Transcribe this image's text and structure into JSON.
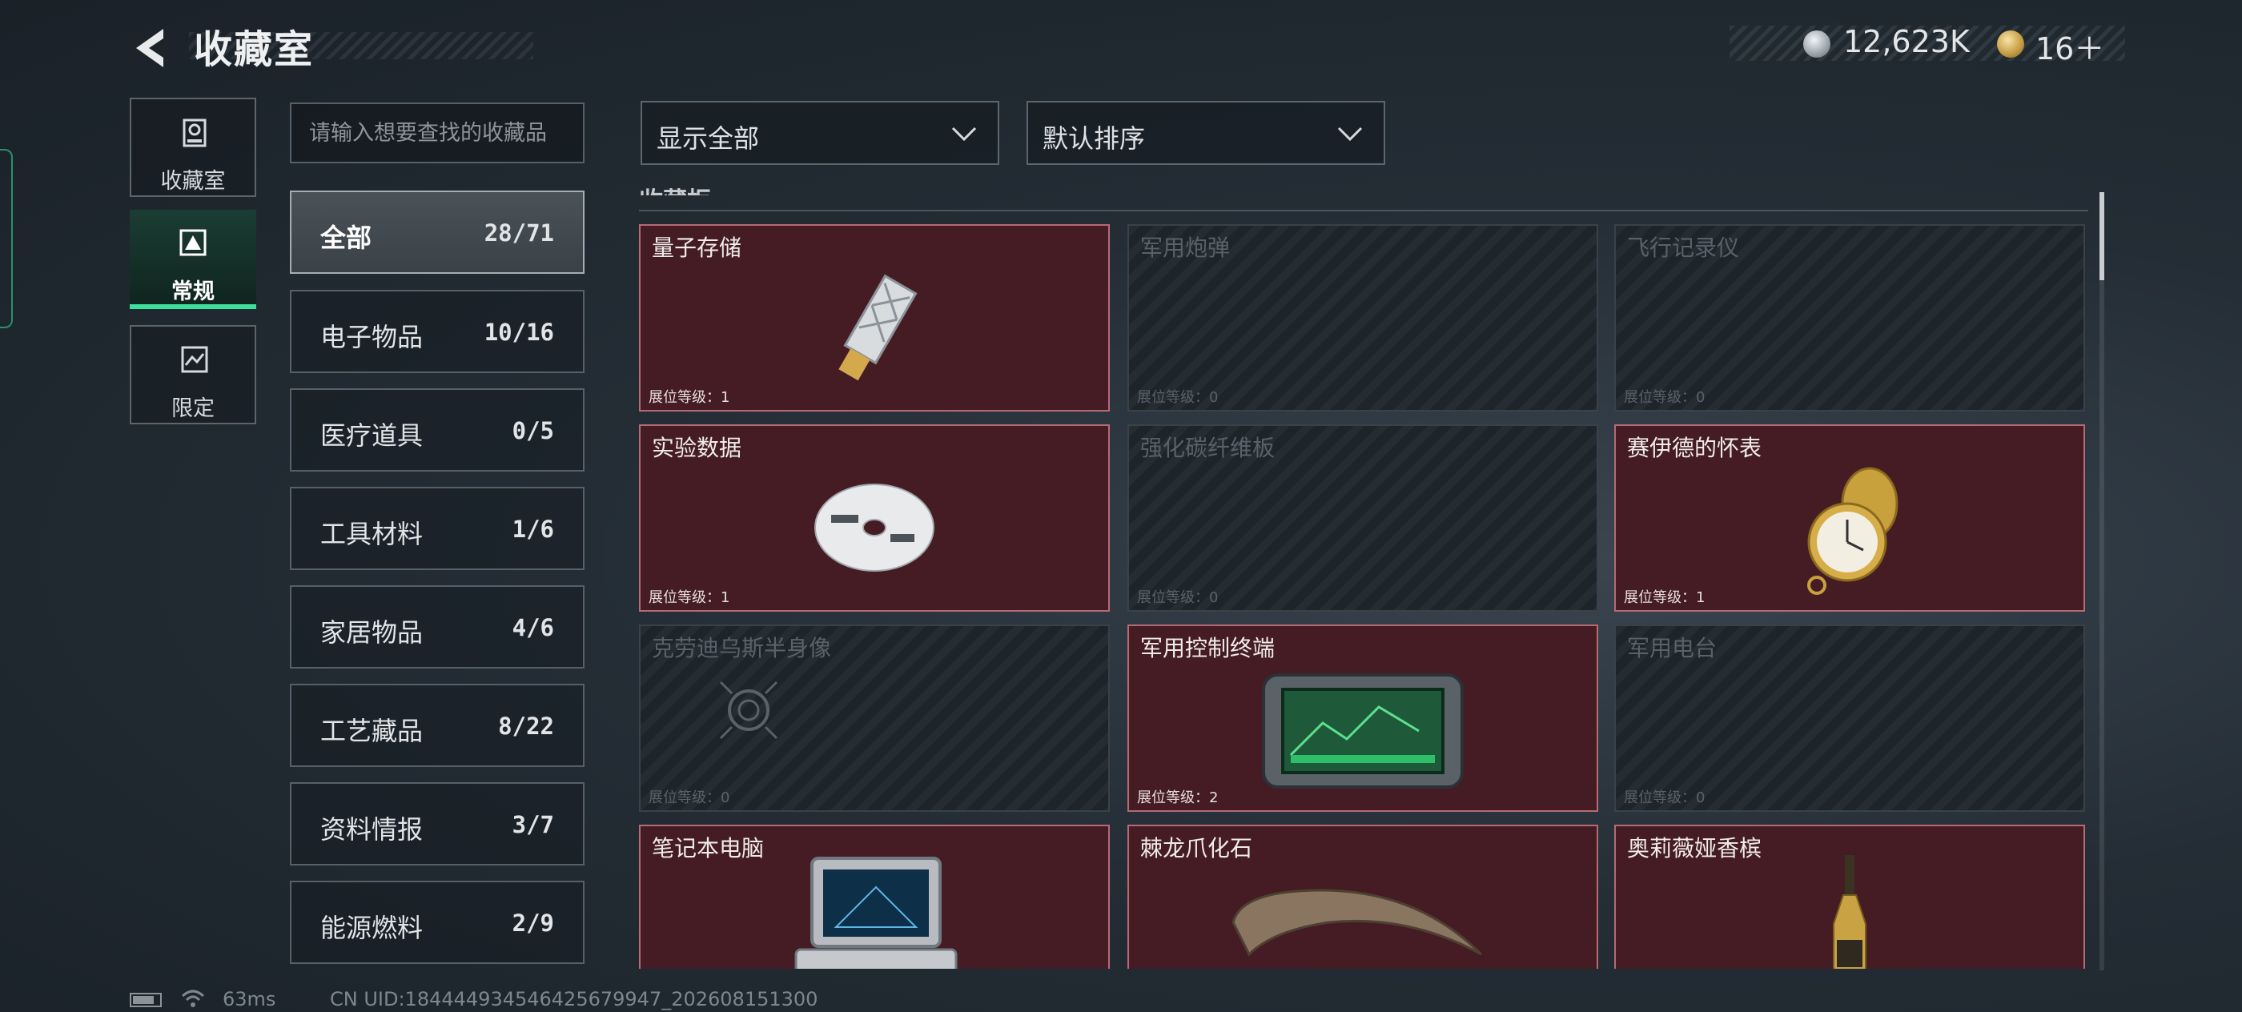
{
  "header": {
    "title": "收藏室",
    "currencies": [
      {
        "icon": "silver-coin-icon",
        "amount": "12,623K"
      },
      {
        "icon": "gold-coin-icon",
        "amount": "16＋"
      }
    ]
  },
  "side_tabs": [
    {
      "label": "收藏室",
      "icon": "collection-room-icon",
      "active": false
    },
    {
      "label": "常规",
      "icon": "regular-icon",
      "active": true
    },
    {
      "label": "限定",
      "icon": "limited-icon",
      "active": false
    }
  ],
  "search": {
    "placeholder": "请输入想要查找的收藏品",
    "value": ""
  },
  "categories": [
    {
      "name": "全部",
      "count": "28/71",
      "active": true
    },
    {
      "name": "电子物品",
      "count": "10/16",
      "active": false
    },
    {
      "name": "医疗道具",
      "count": "0/5",
      "active": false
    },
    {
      "name": "工具材料",
      "count": "1/6",
      "active": false
    },
    {
      "name": "家居物品",
      "count": "4/6",
      "active": false
    },
    {
      "name": "工艺藏品",
      "count": "8/22",
      "active": false
    },
    {
      "name": "资料情报",
      "count": "3/7",
      "active": false
    },
    {
      "name": "能源燃料",
      "count": "2/9",
      "active": false
    }
  ],
  "filters": {
    "display": {
      "selected": "显示全部"
    },
    "sort": {
      "selected": "默认排序"
    }
  },
  "section": {
    "header": "收藏柜"
  },
  "items": [
    {
      "name": "量子存储",
      "level": "展位等级：1",
      "owned": true,
      "icon": "usb-drive-icon"
    },
    {
      "name": "军用炮弹",
      "level": "展位等级：0",
      "owned": false,
      "icon": "artillery-shell-icon"
    },
    {
      "name": "飞行记录仪",
      "level": "展位等级：0",
      "owned": false,
      "icon": "flight-recorder-icon"
    },
    {
      "name": "实验数据",
      "level": "展位等级：1",
      "owned": true,
      "icon": "disc-icon"
    },
    {
      "name": "强化碳纤维板",
      "level": "展位等级：0",
      "owned": false,
      "icon": "carbon-plate-icon"
    },
    {
      "name": "赛伊德的怀表",
      "level": "展位等级：1",
      "owned": true,
      "icon": "pocket-watch-icon"
    },
    {
      "name": "克劳迪乌斯半身像",
      "level": "展位等级：0",
      "owned": false,
      "icon": "bust-icon"
    },
    {
      "name": "军用控制终端",
      "level": "展位等级：2",
      "owned": true,
      "icon": "control-terminal-icon"
    },
    {
      "name": "军用电台",
      "level": "展位等级：0",
      "owned": false,
      "icon": "radio-icon"
    },
    {
      "name": "笔记本电脑",
      "level": "",
      "owned": true,
      "icon": "laptop-icon"
    },
    {
      "name": "棘龙爪化石",
      "level": "",
      "owned": true,
      "icon": "claw-fossil-icon"
    },
    {
      "name": "奥莉薇娅香槟",
      "level": "",
      "owned": true,
      "icon": "champagne-icon"
    }
  ],
  "status_bar": {
    "ping": "63ms",
    "uid": "CN UID:1844449345464256799​47_202608151300"
  },
  "colors": {
    "accent": "#3ce09a",
    "owned_card": "#451c23",
    "locked_card": "#1d242a"
  }
}
